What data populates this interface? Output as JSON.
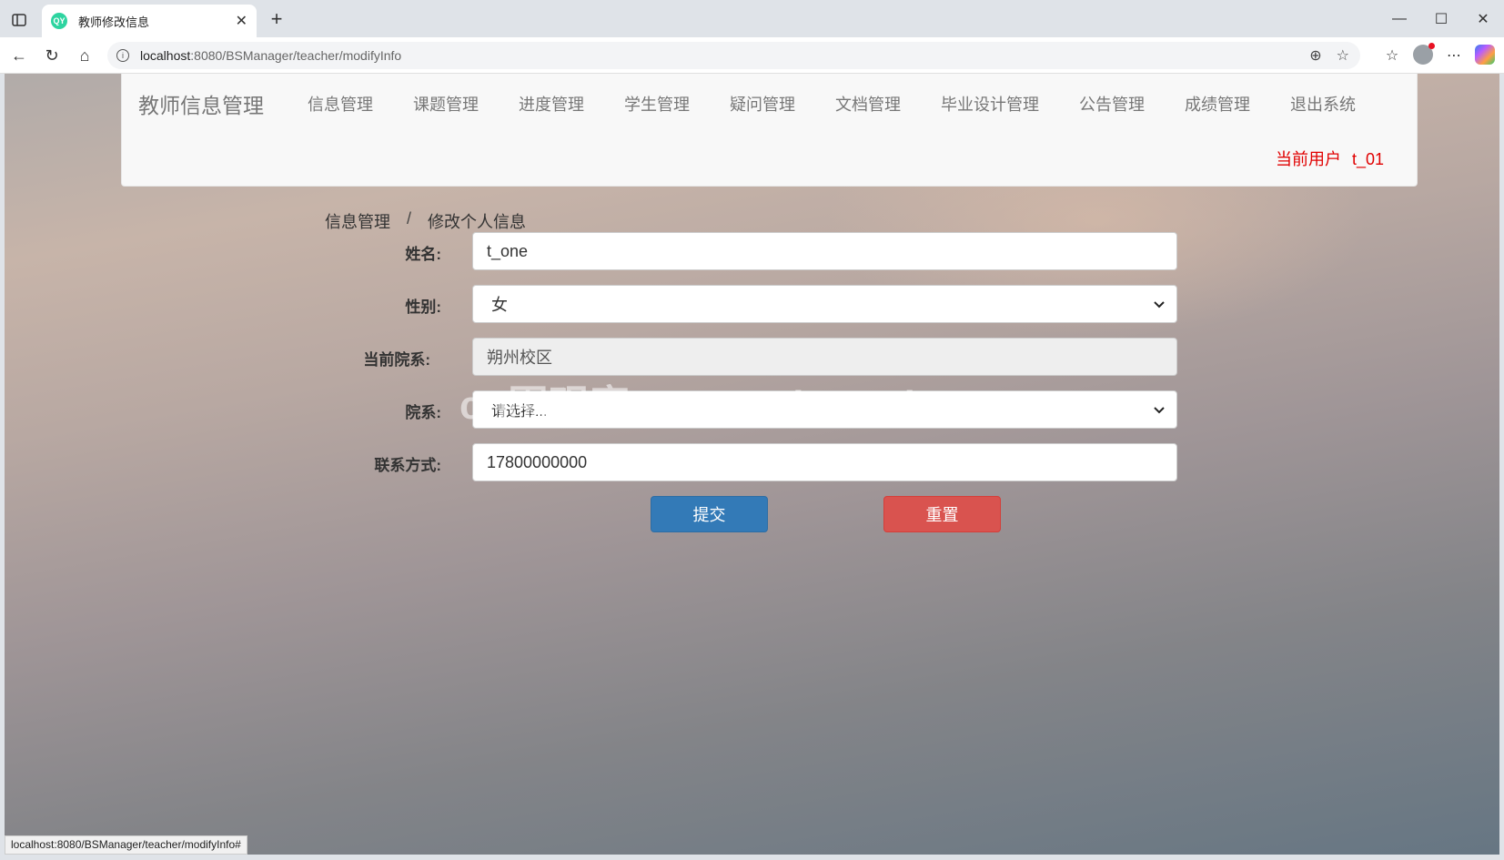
{
  "browser": {
    "tab_title": "教师修改信息",
    "favicon_text": "QY",
    "url_host": "localhost",
    "url_rest": ":8080/BSManager/teacher/modifyInfo",
    "status_url": "localhost:8080/BSManager/teacher/modifyInfo#"
  },
  "navbar": {
    "brand": "教师信息管理",
    "menu": [
      "信息管理",
      "课题管理",
      "进度管理",
      "学生管理",
      "疑问管理",
      "文档管理",
      "毕业设计管理",
      "公告管理",
      "成绩管理",
      "退出系统"
    ],
    "current_user_label": "当前用户",
    "current_user_value": "t_01"
  },
  "breadcrumb": {
    "parent": "信息管理",
    "separator": "/",
    "current": "修改个人信息"
  },
  "form": {
    "name_label": "姓名:",
    "name_value": "t_one",
    "gender_label": "性别:",
    "gender_value": "女",
    "current_dept_label": "当前院系:",
    "current_dept_value": "朔州校区",
    "dept_label": "院系:",
    "dept_value": "请选择...",
    "contact_label": "联系方式:",
    "contact_value": "17800000000",
    "submit": "提交",
    "reset": "重置"
  },
  "watermark": "cn围观客www.weiguanke.cn",
  "colors": {
    "primary": "#337ab7",
    "danger": "#d9534f",
    "user_text": "#e00000"
  }
}
